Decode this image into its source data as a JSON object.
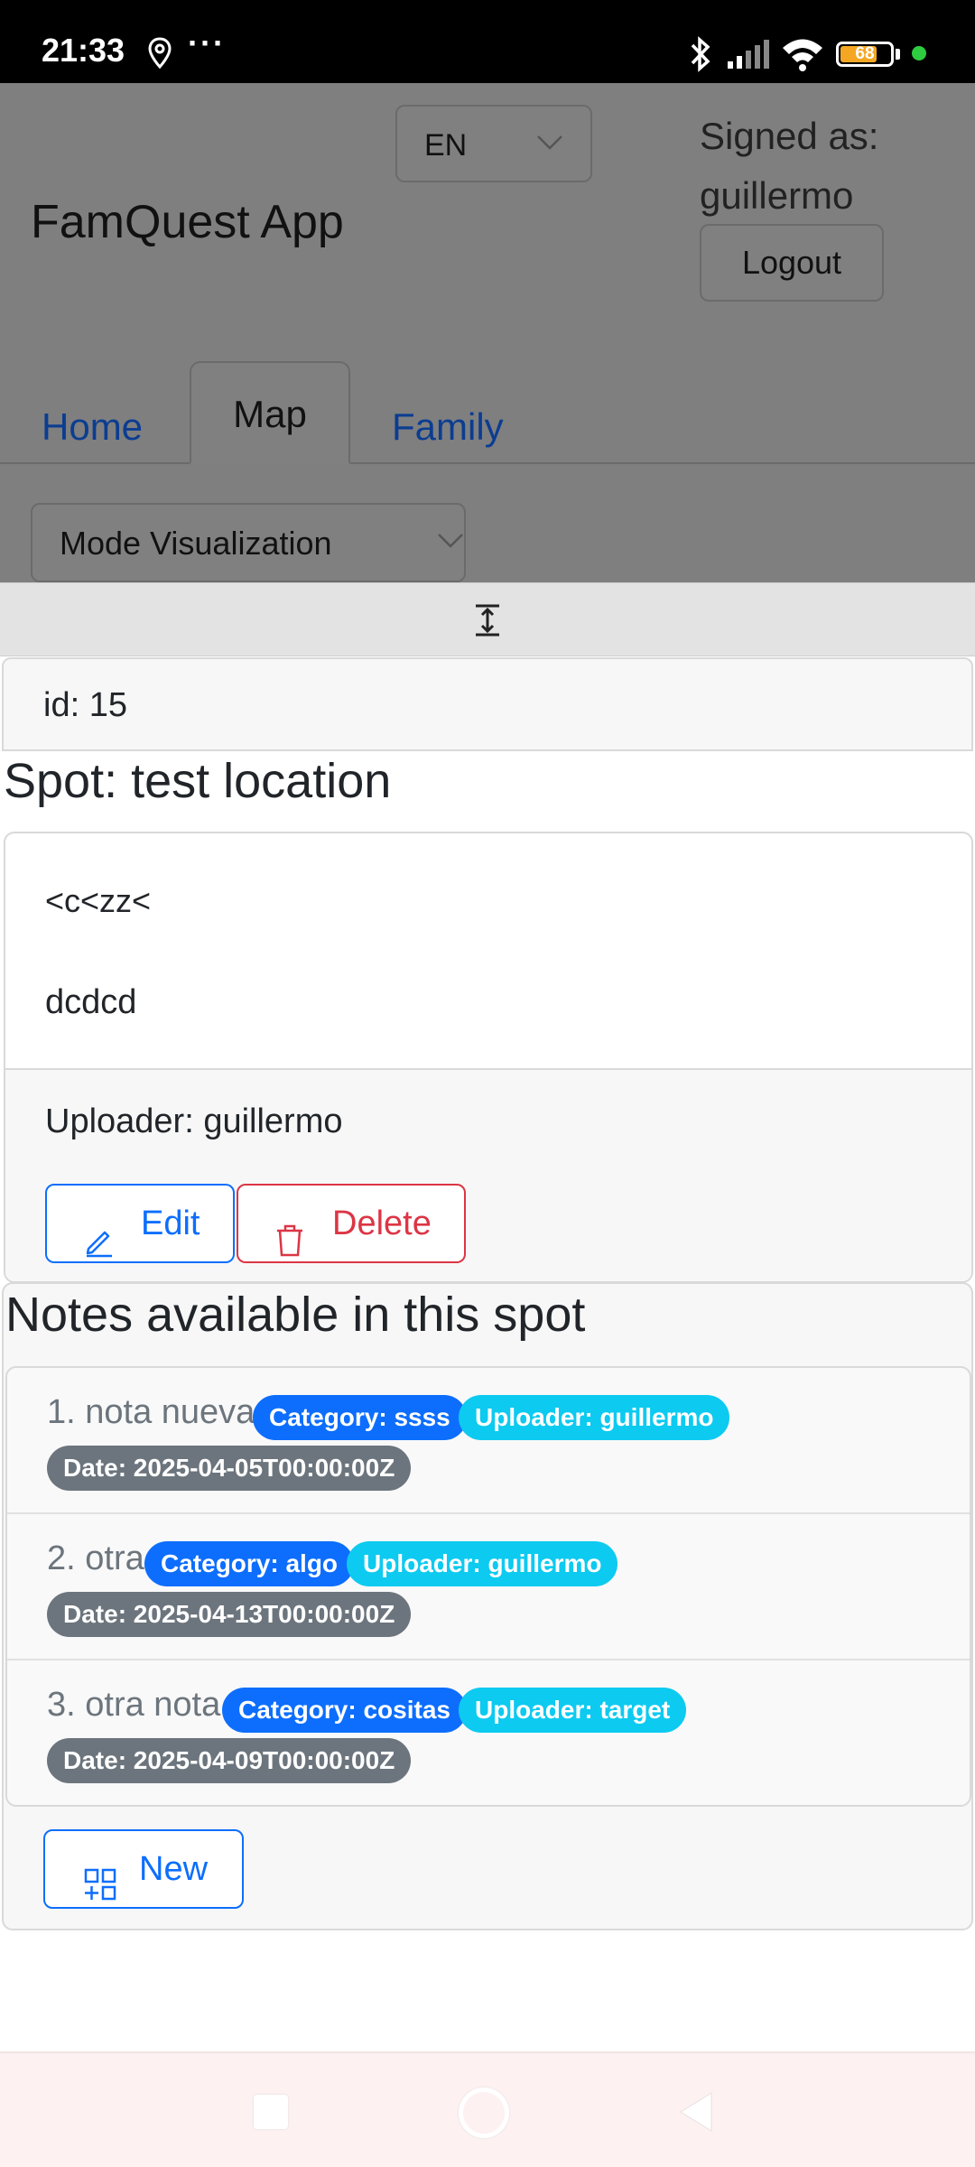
{
  "status_bar": {
    "time": "21:33",
    "battery": "68",
    "icons": [
      "location-icon",
      "more-dots-icon",
      "bluetooth-icon",
      "signal-icon",
      "wifi-icon",
      "battery-icon",
      "notification-dot"
    ],
    "dots": "···"
  },
  "header": {
    "language": "EN",
    "app_title": "FamQuest App",
    "signed_as_label": "Signed as:",
    "username": "guillermo",
    "logout_label": "Logout"
  },
  "tabs": [
    {
      "label": "Home",
      "active": false
    },
    {
      "label": "Map",
      "active": true
    },
    {
      "label": "Family",
      "active": false
    }
  ],
  "mode_select": {
    "value": "Mode Visualization"
  },
  "spot": {
    "id_text": "id: 15",
    "title": "Spot: test location",
    "description_line1": "<c<zz<",
    "description_line2": "dcdcd",
    "uploader": "Uploader: guillermo",
    "edit_label": "Edit",
    "delete_label": "Delete"
  },
  "notes": {
    "title": "Notes available in this spot",
    "items": [
      {
        "title": "1. nota nueva",
        "category": "Category: ssss",
        "uploader": "Uploader: guillermo",
        "date": "Date: 2025-04-05T00:00:00Z"
      },
      {
        "title": "2. otra",
        "category": "Category: algo",
        "uploader": "Uploader: guillermo",
        "date": "Date: 2025-04-13T00:00:00Z"
      },
      {
        "title": "3. otra nota",
        "category": "Category: cositas",
        "uploader": "Uploader: target",
        "date": "Date: 2025-04-09T00:00:00Z"
      }
    ],
    "new_label": "New"
  },
  "colors": {
    "primary": "#0d6efd",
    "danger": "#dc3545",
    "info": "#0dcaf0",
    "secondary": "#6c757d",
    "overlay": "#7f7f7f"
  }
}
